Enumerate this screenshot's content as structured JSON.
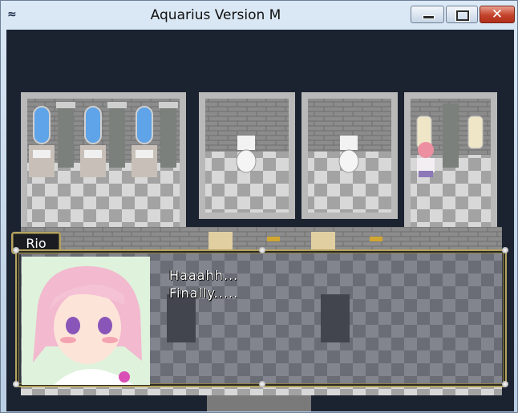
{
  "window": {
    "title": "Aquarius Version M",
    "icon": "aquarius-symbol-icon",
    "icon_glyph": "≈"
  },
  "dialog": {
    "speaker": "Rio",
    "lines": [
      "Haaahh...",
      "Finally....."
    ],
    "text": "Haaahh...\nFinally....."
  },
  "colors": {
    "floor_light": "#d8d8d8",
    "floor_dark": "#9c9c9c",
    "wall": "#8a8a8a",
    "mirror": "#5fa3e8",
    "background": "#1b2230",
    "frame_gold": "#b5a35e"
  }
}
